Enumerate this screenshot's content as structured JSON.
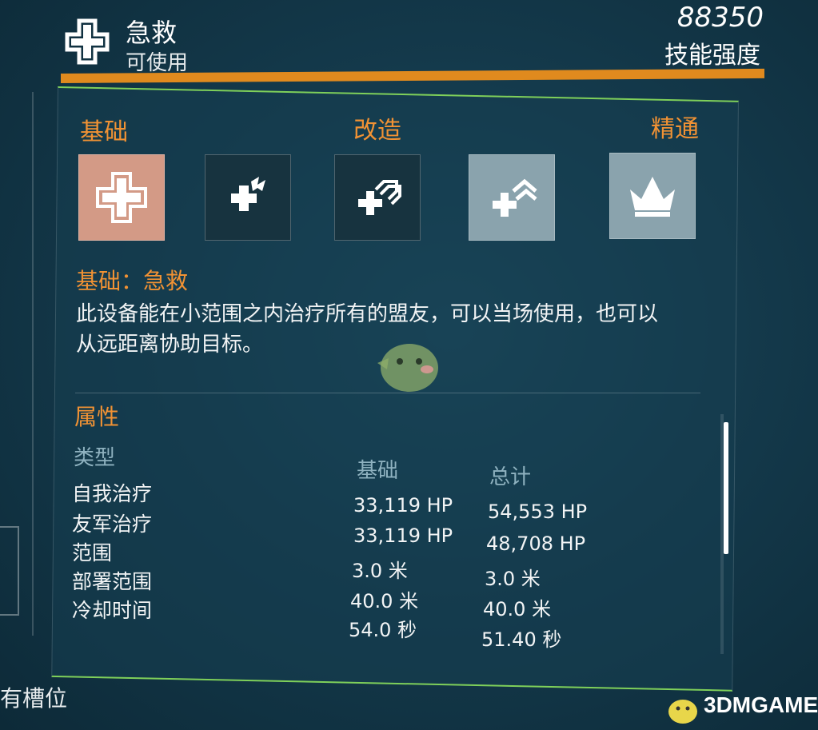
{
  "header": {
    "skill_name": "急救",
    "skill_status": "可使用",
    "power_value": "88350",
    "power_label": "技能强度",
    "icon": "first-aid-cross-icon"
  },
  "tiers": {
    "basic": "基础",
    "mod": "改造",
    "mastery": "精通"
  },
  "mods": [
    {
      "icon": "first-aid-cross-icon",
      "state": "selected"
    },
    {
      "icon": "defibrillator-icon",
      "state": "available"
    },
    {
      "icon": "overdose-icon",
      "state": "available"
    },
    {
      "icon": "ultimate-support-icon",
      "state": "locked"
    },
    {
      "icon": "crown-icon",
      "state": "locked"
    }
  ],
  "description": {
    "title": "基础：急救",
    "text": "此设备能在小范围之内治疗所有的盟友，可以当场使用，也可以从远距离协助目标。"
  },
  "attributes": {
    "title": "属性",
    "type_header": "类型",
    "base_header": "基础",
    "total_header": "总计",
    "rows": [
      {
        "label": "自我治疗",
        "base": "33,119 HP",
        "total": "54,553 HP"
      },
      {
        "label": "友军治疗",
        "base": "33,119 HP",
        "total": "48,708 HP"
      },
      {
        "label": "范围",
        "base": "3.0 米",
        "total": "3.0 米"
      },
      {
        "label": "部署范围",
        "base": "40.0 米",
        "total": "40.0 米"
      },
      {
        "label": "冷却时间",
        "base": "54.0 秒",
        "total": "51.40 秒"
      }
    ]
  },
  "footer": {
    "slot_label": "有槽位"
  },
  "watermark": {
    "logo_text": "3DMGAME"
  },
  "colors": {
    "accent_orange": "#f19234",
    "border_green": "#7fd05a",
    "background": "#143a4c",
    "selected_tile": "#d39a86"
  }
}
